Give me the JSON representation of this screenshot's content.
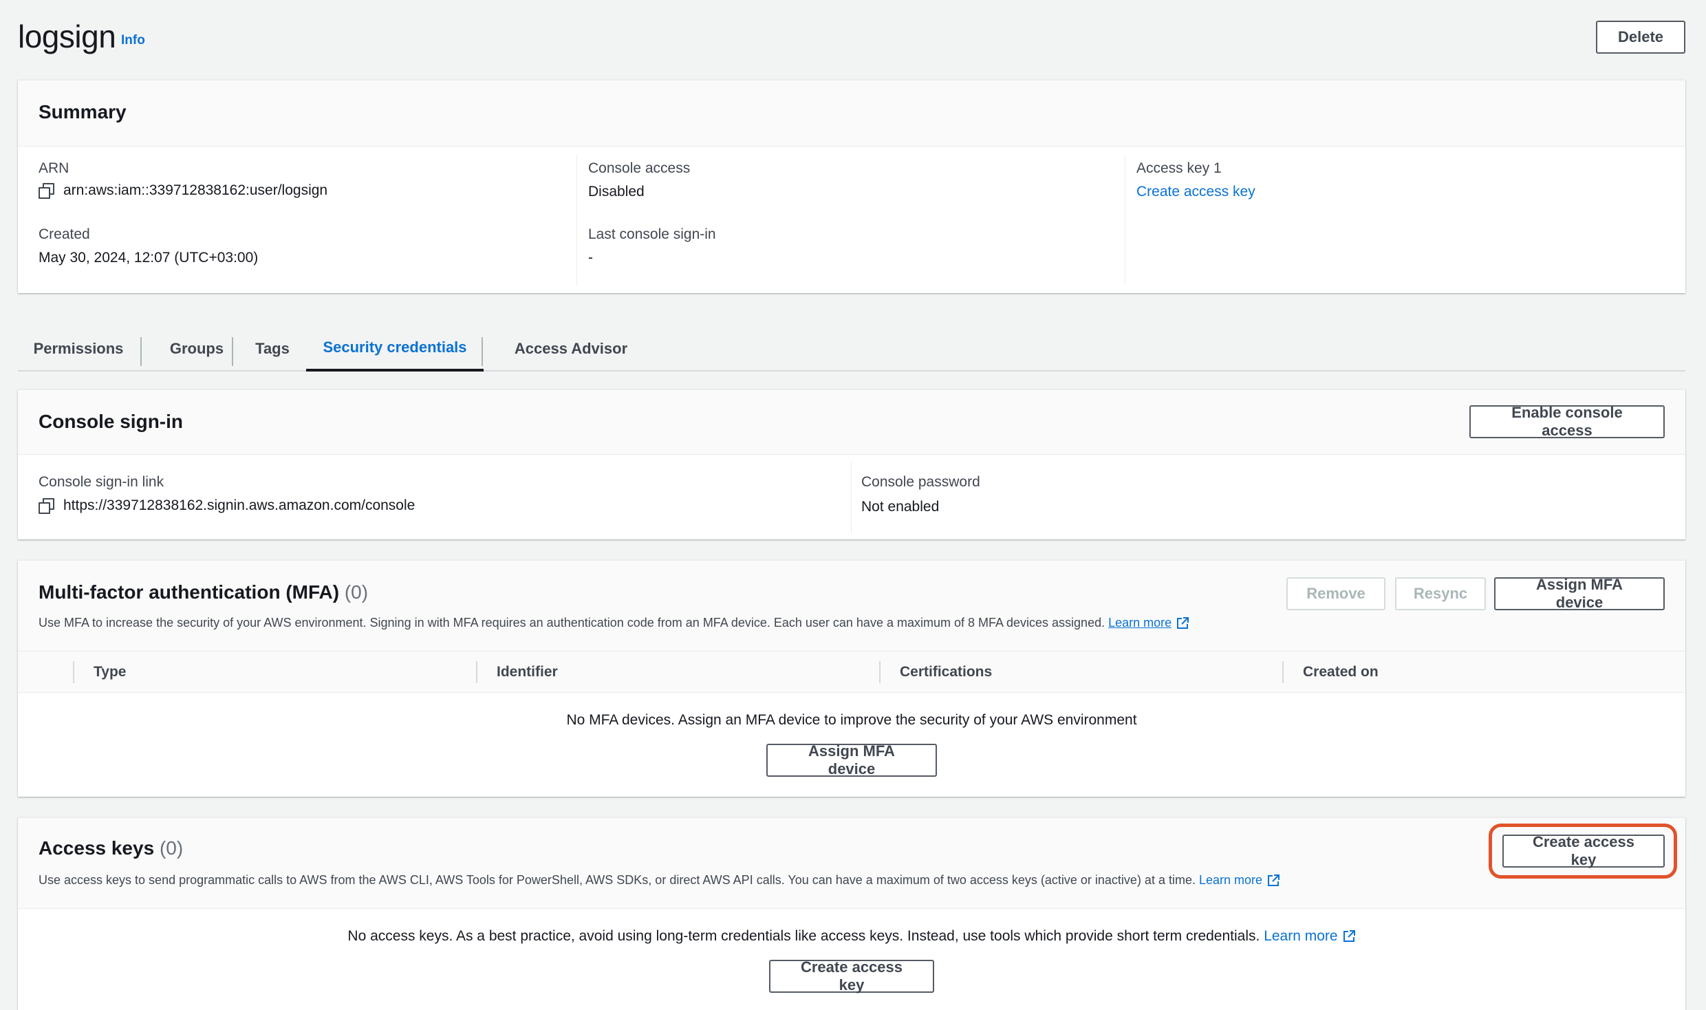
{
  "header": {
    "title": "logsign",
    "info_label": "Info",
    "delete_label": "Delete"
  },
  "summary": {
    "title": "Summary",
    "arn_label": "ARN",
    "arn_value": "arn:aws:iam::339712838162:user/logsign",
    "created_label": "Created",
    "created_value": "May 30, 2024, 12:07 (UTC+03:00)",
    "console_access_label": "Console access",
    "console_access_value": "Disabled",
    "last_signin_label": "Last console sign-in",
    "last_signin_value": "-",
    "access_key_label": "Access key 1",
    "access_key_link": "Create access key"
  },
  "tabs": [
    {
      "label": "Permissions"
    },
    {
      "label": "Groups"
    },
    {
      "label": "Tags"
    },
    {
      "label": "Security credentials"
    },
    {
      "label": "Access Advisor"
    }
  ],
  "console_signin": {
    "title": "Console sign-in",
    "enable_button": "Enable console access",
    "link_label": "Console sign-in link",
    "link_value": "https://339712838162.signin.aws.amazon.com/console",
    "password_label": "Console password",
    "password_value": "Not enabled"
  },
  "mfa": {
    "title": "Multi-factor authentication (MFA)",
    "count": "(0)",
    "description": "Use MFA to increase the security of your AWS environment. Signing in with MFA requires an authentication code from an MFA device. Each user can have a maximum of 8 MFA devices assigned.",
    "learn_more": "Learn more",
    "remove_button": "Remove",
    "resync_button": "Resync",
    "assign_button": "Assign MFA device",
    "columns": [
      "Type",
      "Identifier",
      "Certifications",
      "Created on"
    ],
    "empty_message": "No MFA devices. Assign an MFA device to improve the security of your AWS environment",
    "empty_button": "Assign MFA device"
  },
  "access_keys": {
    "title": "Access keys",
    "count": "(0)",
    "description": "Use access keys to send programmatic calls to AWS from the AWS CLI, AWS Tools for PowerShell, AWS SDKs, or direct AWS API calls. You can have a maximum of two access keys (active or inactive) at a time.",
    "learn_more": "Learn more",
    "create_button": "Create access key",
    "empty_message": "No access keys. As a best practice, avoid using long-term credentials like access keys. Instead, use tools which provide short term credentials.",
    "empty_learn_more": "Learn more",
    "empty_button": "Create access key"
  },
  "colors": {
    "accent": "#0972d3",
    "highlight": "#e0532b"
  }
}
